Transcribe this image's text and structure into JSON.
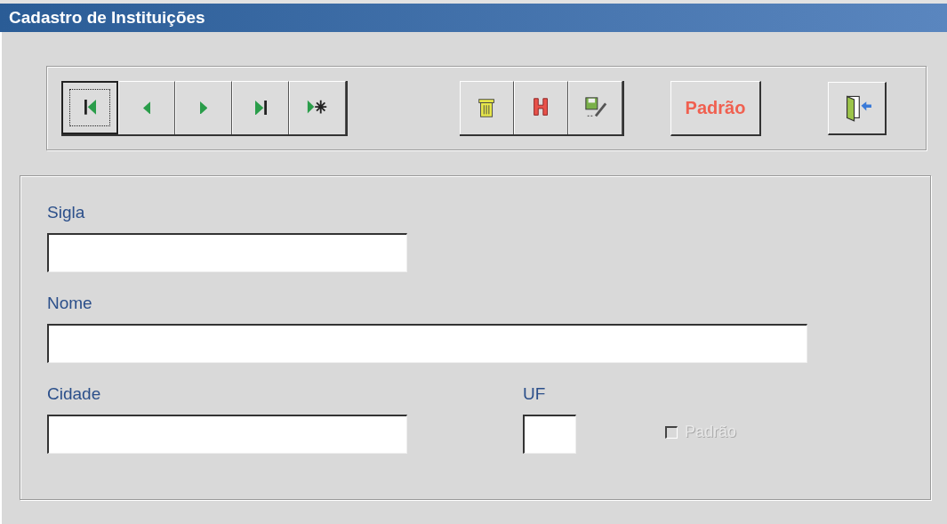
{
  "window": {
    "title": "Cadastro de Instituições"
  },
  "nav_buttons": [
    {
      "kind": "first",
      "focused": true
    },
    {
      "kind": "prev",
      "focused": false
    },
    {
      "kind": "next",
      "focused": false
    },
    {
      "kind": "last",
      "focused": false
    },
    {
      "kind": "new",
      "focused": false
    }
  ],
  "action_buttons": [
    {
      "kind": "delete"
    },
    {
      "kind": "help"
    },
    {
      "kind": "save"
    }
  ],
  "default_button": {
    "label": "Padrão"
  },
  "exit_button": {
    "kind": "exit"
  },
  "fields": [
    {
      "label": "Sigla"
    },
    {
      "label": "Nome"
    }
  ],
  "last_row": [
    {
      "kind": "field",
      "label": "Cidade"
    },
    {
      "kind": "field",
      "label": "UF"
    },
    {
      "kind": "checkbox",
      "label": "Padrão",
      "checked": false,
      "disabled": true
    }
  ]
}
